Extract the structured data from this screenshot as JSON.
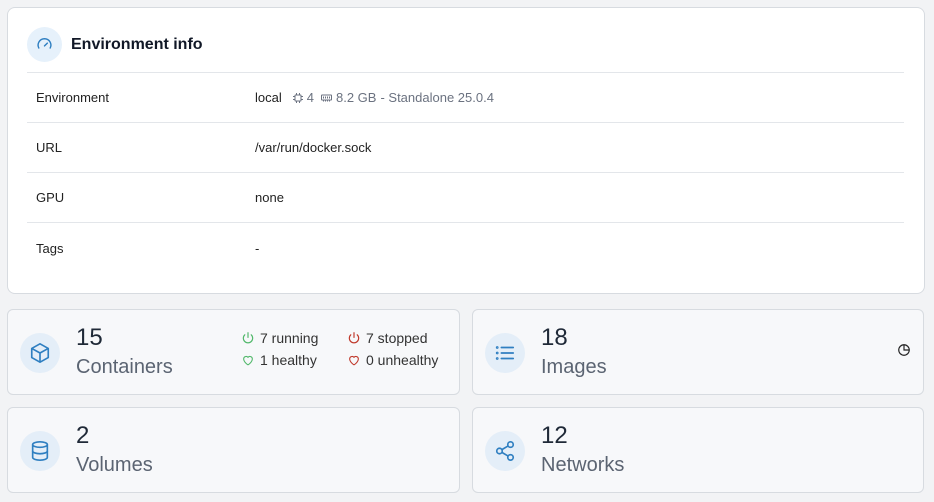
{
  "environment_info": {
    "title": "Environment info",
    "rows": {
      "environment": {
        "label": "Environment",
        "name": "local",
        "cpu": "4",
        "memory": "8.2 GB",
        "version": "- Standalone 25.0.4"
      },
      "url": {
        "label": "URL",
        "value": "/var/run/docker.sock"
      },
      "gpu": {
        "label": "GPU",
        "value": "none"
      },
      "tags": {
        "label": "Tags",
        "value": "-"
      }
    }
  },
  "stats": {
    "containers": {
      "count": "15",
      "label": "Containers",
      "running": "7 running",
      "stopped": "7 stopped",
      "healthy": "1 healthy",
      "unhealthy": "0 unhealthy"
    },
    "images": {
      "count": "18",
      "label": "Images"
    },
    "volumes": {
      "count": "2",
      "label": "Volumes"
    },
    "networks": {
      "count": "12",
      "label": "Networks"
    }
  },
  "icons": {
    "header": "gauge-icon",
    "cpu": "cpu-icon",
    "memory": "memory-icon",
    "containers": "box-icon",
    "images": "list-icon",
    "volumes": "database-icon",
    "networks": "share-icon",
    "running": "power-icon",
    "stopped": "power-icon",
    "healthy": "heart-icon",
    "unhealthy": "heart-icon",
    "image_usage": "pie-chart-icon"
  },
  "colors": {
    "accent": "#2f7fc1",
    "running": "#51b86a",
    "stopped": "#c0392b",
    "healthy": "#51b86a",
    "unhealthy": "#c0392b"
  }
}
